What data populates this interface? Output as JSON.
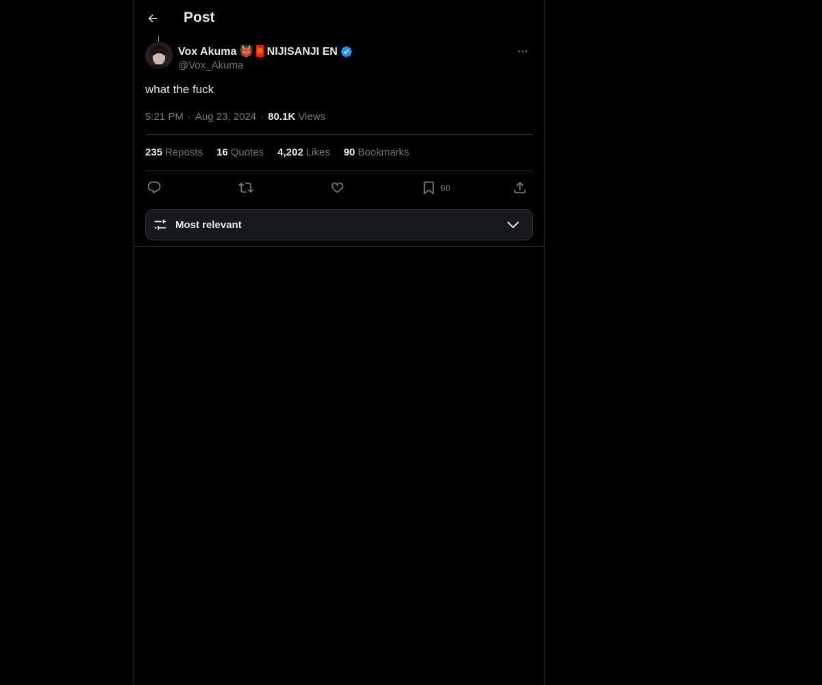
{
  "header": {
    "title": "Post"
  },
  "post": {
    "author": {
      "display_name": "Vox Akuma 👹🧧NIJISANJI EN",
      "handle": "@Vox_Akuma",
      "verified": true
    },
    "text": "what the fuck",
    "time": "5:21 PM",
    "date": "Aug 23, 2024",
    "views_count": "80.1K",
    "views_label": "Views"
  },
  "stats": [
    {
      "count": "235",
      "label": "Reposts"
    },
    {
      "count": "16",
      "label": "Quotes"
    },
    {
      "count": "4,202",
      "label": "Likes"
    },
    {
      "count": "90",
      "label": "Bookmarks"
    }
  ],
  "actions": {
    "bookmark_count": "90"
  },
  "sort": {
    "label": "Most relevant"
  },
  "colors": {
    "background": "#000000",
    "text_primary": "#e7e9ea",
    "text_secondary": "#71767b",
    "border": "#2f3336",
    "verified_blue": "#1d9bf0"
  },
  "icons": {
    "back": "arrow-left-icon",
    "more": "more-horizontal-icon",
    "verified": "verified-badge-icon",
    "reply": "reply-icon",
    "repost": "repost-icon",
    "like": "heart-icon",
    "bookmark": "bookmark-icon",
    "share": "share-icon",
    "sort": "sliders-icon",
    "chevron": "chevron-down-icon"
  }
}
